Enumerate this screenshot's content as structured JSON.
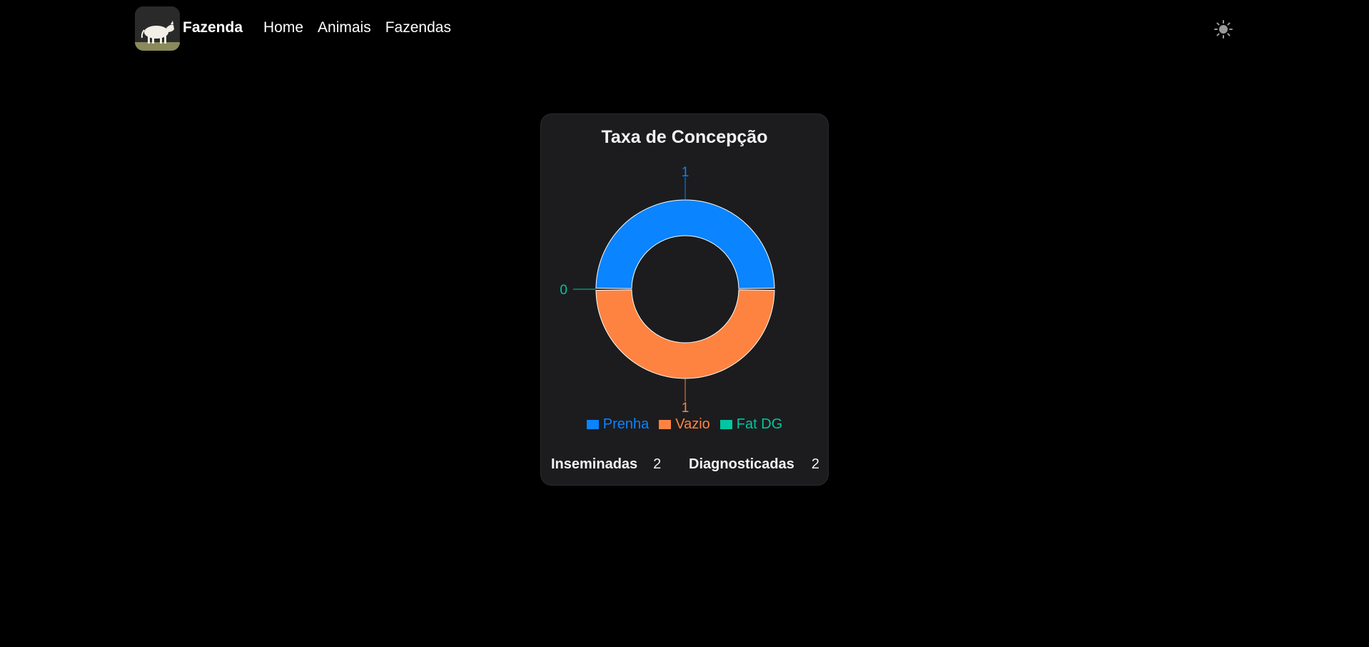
{
  "navbar": {
    "brand": "Fazenda",
    "links": [
      "Home",
      "Animais",
      "Fazendas"
    ]
  },
  "card": {
    "title": "Taxa de Concepção",
    "stats": {
      "inseminadas_label": "Inseminadas",
      "inseminadas_value": "2",
      "diagnosticadas_label": "Diagnosticadas",
      "diagnosticadas_value": "2"
    }
  },
  "chart_data": {
    "type": "pie",
    "categories": [
      "Prenha",
      "Vazio",
      "Fat DG"
    ],
    "values": [
      1,
      1,
      0
    ],
    "colors": [
      "#0a84ff",
      "#ff8340",
      "#00c7a0"
    ],
    "data_labels": [
      "1",
      "1",
      "0"
    ],
    "legend_position": "bottom"
  },
  "icons": {
    "logo": "cow-icon",
    "theme": "sun-icon"
  }
}
